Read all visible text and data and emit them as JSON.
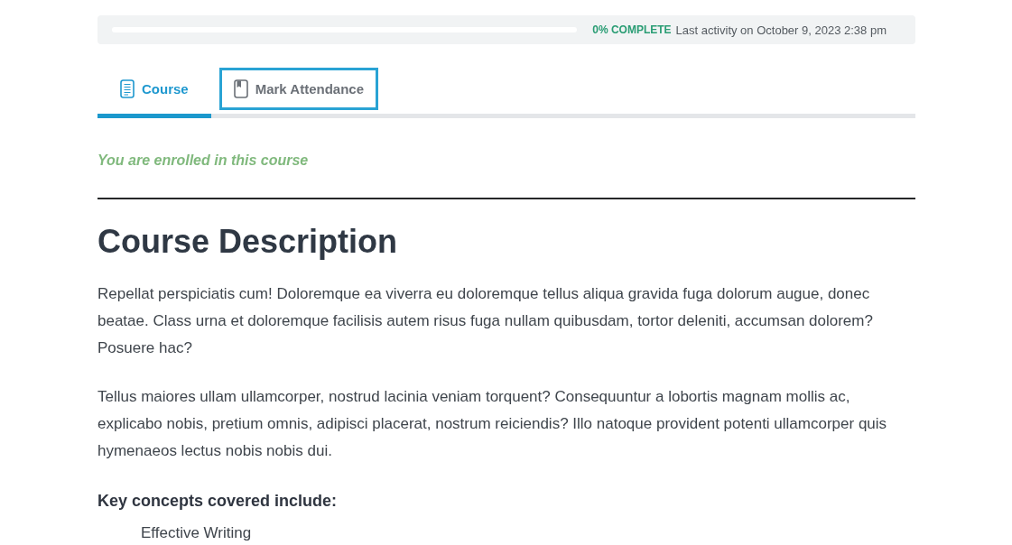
{
  "progress": {
    "level": 0,
    "label": "0% COMPLETE",
    "last_activity": "Last activity on October 9, 2023 2:38 pm"
  },
  "tabs": [
    {
      "label": "Course",
      "selected": true,
      "focused": false
    },
    {
      "label": "Mark Attendance",
      "selected": false,
      "focused": true
    }
  ],
  "enrollment_status": "You are enrolled in this course",
  "description": {
    "title": "Course Description",
    "paragraphs": [
      "Repellat perspiciatis cum! Doloremque ea viverra eu doloremque tellus aliqua gravida fuga dolorum augue, donec beatae. Class urna et doloremque facilisis autem risus fuga nullam quibusdam, tortor deleniti, accumsan dolorem? Posuere hac?",
      "Tellus maiores ullam ullamcorper, nostrud lacinia veniam torquent? Consequuntur a lobortis magnam mollis ac, explicabo nobis, pretium omnis, adipisci placerat, nostrum reiciendis? Illo natoque provident potenti ullamcorper quis hymenaeos lectus nobis nobis dui."
    ],
    "subheading": "Key concepts covered include:",
    "concepts": [
      "Effective Writing"
    ]
  }
}
